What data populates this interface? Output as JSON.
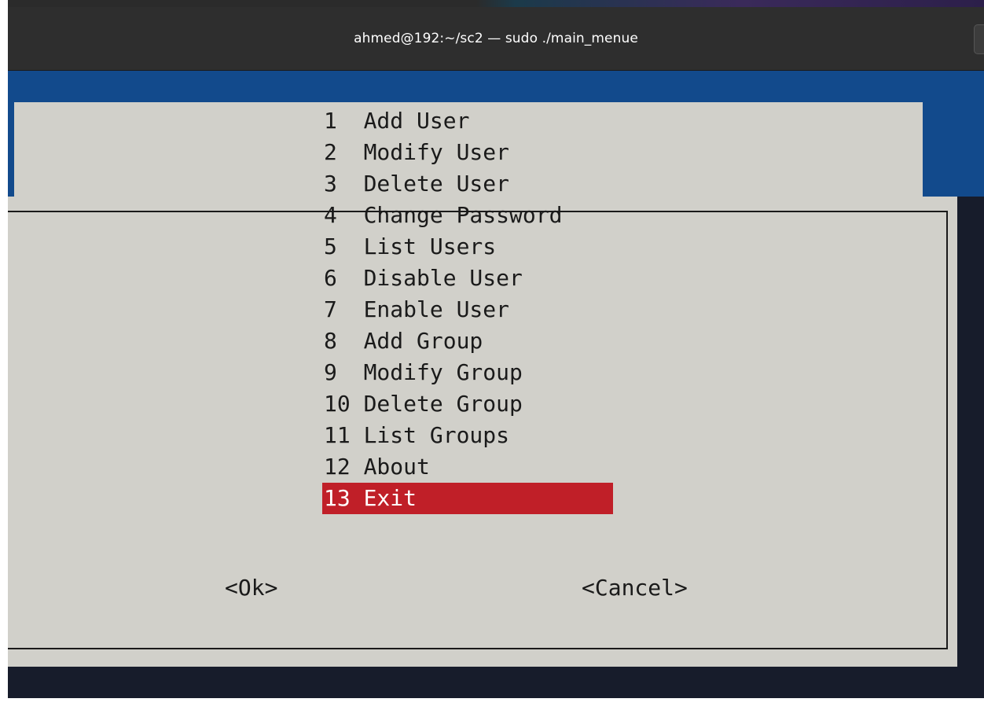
{
  "window": {
    "title": "ahmed@192:~/sc2 — sudo ./main_menue"
  },
  "menu": {
    "items": [
      {
        "label": "1  Add User"
      },
      {
        "label": "2  Modify User"
      },
      {
        "label": "3  Delete User"
      },
      {
        "label": "4  Change Password"
      },
      {
        "label": "5  List Users"
      },
      {
        "label": "6  Disable User"
      },
      {
        "label": "7  Enable User"
      },
      {
        "label": "8  Add Group"
      },
      {
        "label": "9  Modify Group"
      },
      {
        "label": "10 Delete Group"
      },
      {
        "label": "11 List Groups"
      },
      {
        "label": "12 About"
      },
      {
        "label": "13 Exit"
      }
    ],
    "selected": "13 Exit"
  },
  "buttons": {
    "ok": "<Ok>",
    "cancel": "<Cancel>"
  },
  "colors": {
    "terminal_background": "#124a8c",
    "dialog_background": "#d1d0ca",
    "selection_highlight": "#c01f28",
    "titlebar": "#2e2e2e"
  }
}
